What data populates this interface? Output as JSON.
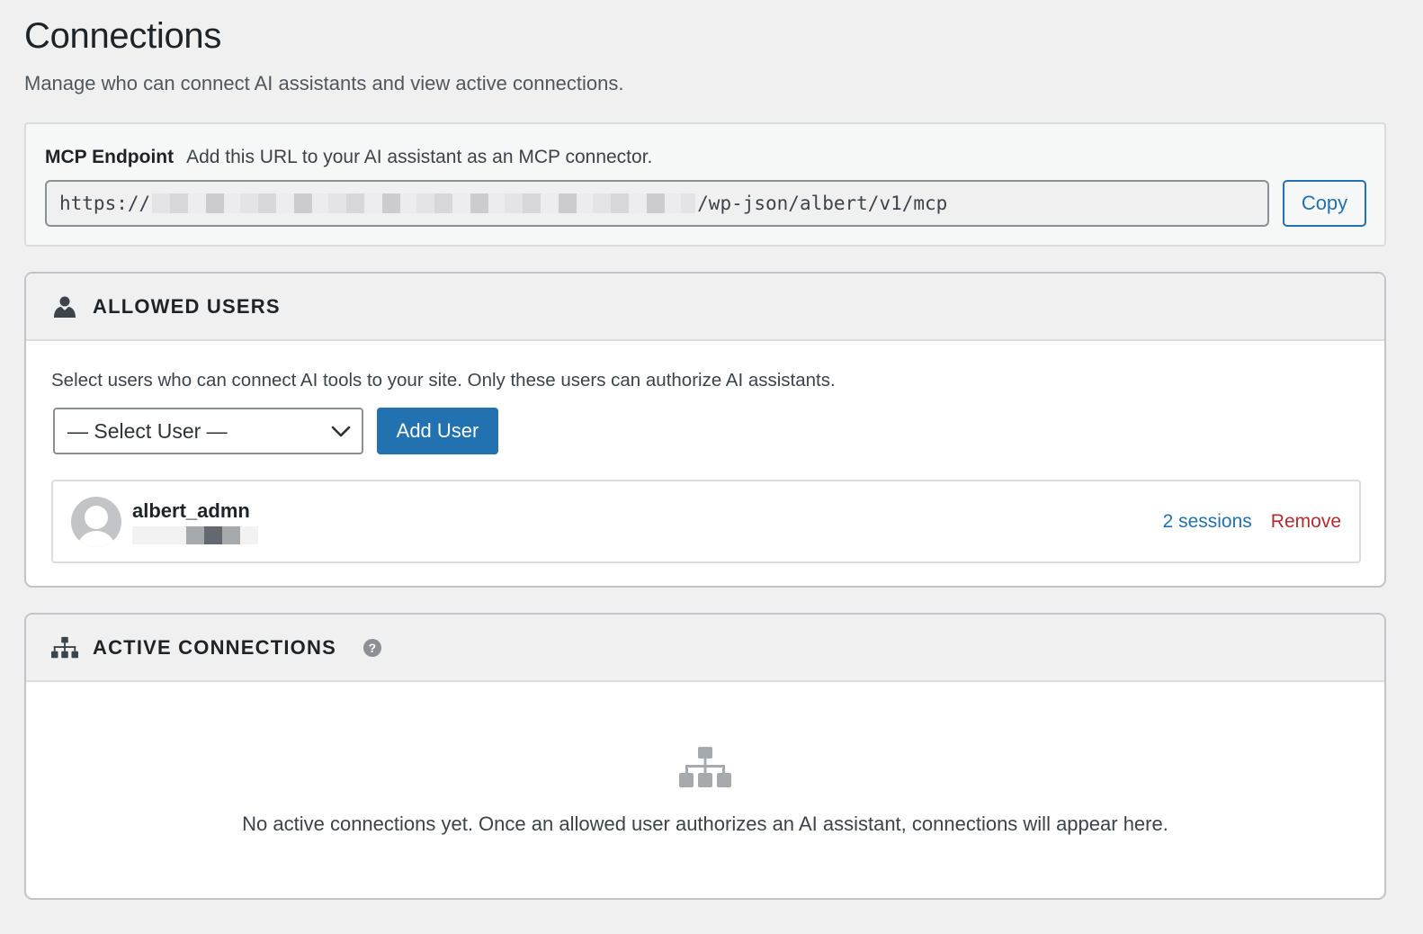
{
  "page": {
    "title": "Connections",
    "description": "Manage who can connect AI assistants and view active connections."
  },
  "endpoint": {
    "label": "MCP Endpoint",
    "hint": "Add this URL to your AI assistant as an MCP connector.",
    "url_prefix": "https://",
    "url_suffix": "/wp-json/albert/v1/mcp",
    "copy_label": "Copy"
  },
  "allowed_users": {
    "title": "ALLOWED USERS",
    "icon": "user-icon",
    "description": "Select users who can connect AI tools to your site. Only these users can authorize AI assistants.",
    "select_value": "— Select User —",
    "add_label": "Add User",
    "users": [
      {
        "name": "albert_admn",
        "sessions_label": "2 sessions",
        "remove_label": "Remove"
      }
    ]
  },
  "active_connections": {
    "title": "ACTIVE CONNECTIONS",
    "icon": "sitemap-icon",
    "help_icon": "help-icon",
    "empty_message": "No active connections yet. Once an allowed user authorizes an AI assistant, connections will appear here."
  },
  "colors": {
    "accent": "#2271b1",
    "danger": "#b32d2e",
    "background": "#f0f0f1"
  }
}
